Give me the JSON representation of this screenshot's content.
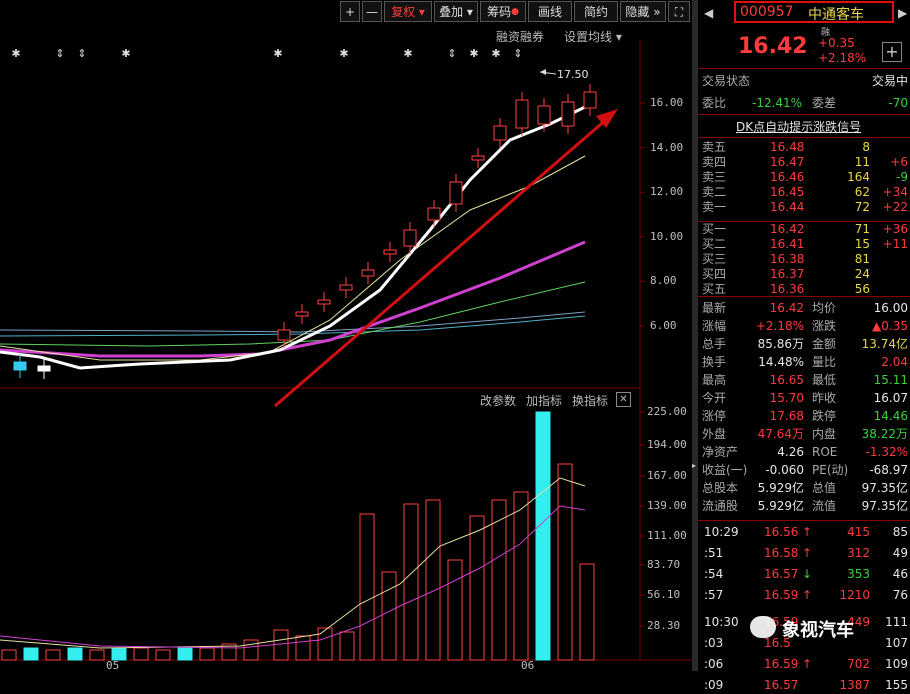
{
  "toolbar": {
    "plus": "+",
    "minus": "—",
    "fuquan": "复权",
    "diejia": "叠加",
    "chouma": "筹码",
    "huaxian": "画线",
    "jianyue": "简约",
    "yincang": "隐藏",
    "expand": "⛶"
  },
  "subbar": {
    "rongzi": "融资融券",
    "junxian": "设置均线"
  },
  "chart": {
    "max_label": "17.50",
    "price_ticks": [
      "16.00",
      "14.00",
      "12.00",
      "10.00",
      "8.00",
      "6.00"
    ],
    "volume_ticks": [
      "225.00",
      "194.00",
      "167.00",
      "139.00",
      "111.00",
      "83.70",
      "56.10",
      "28.30"
    ],
    "x_labels": [
      "05",
      "06"
    ],
    "indicator_buttons": [
      "改参数",
      "加指标",
      "换指标"
    ]
  },
  "stock": {
    "code": "000957",
    "name": "中通客车",
    "rong": "融",
    "price": "16.42",
    "change": "+0.35",
    "change_pct": "+2.18%",
    "status_label": "交易状态",
    "status_value": "交易中",
    "weibi_label": "委比",
    "weibi": "-12.41%",
    "weicha_label": "委差",
    "weicha": "-70",
    "signal": "DK点自动提示涨跌信号"
  },
  "asks": [
    {
      "label": "卖五",
      "price": "16.48",
      "vol": "8",
      "chg": ""
    },
    {
      "label": "卖四",
      "price": "16.47",
      "vol": "11",
      "chg": "+6"
    },
    {
      "label": "卖三",
      "price": "16.46",
      "vol": "164",
      "chg": "-9"
    },
    {
      "label": "卖二",
      "price": "16.45",
      "vol": "62",
      "chg": "+34"
    },
    {
      "label": "卖一",
      "price": "16.44",
      "vol": "72",
      "chg": "+22"
    }
  ],
  "bids": [
    {
      "label": "买一",
      "price": "16.42",
      "vol": "71",
      "chg": "+36"
    },
    {
      "label": "买二",
      "price": "16.41",
      "vol": "15",
      "chg": "+11"
    },
    {
      "label": "买三",
      "price": "16.38",
      "vol": "81",
      "chg": ""
    },
    {
      "label": "买四",
      "price": "16.37",
      "vol": "24",
      "chg": ""
    },
    {
      "label": "买五",
      "price": "16.36",
      "vol": "56",
      "chg": ""
    }
  ],
  "stats": [
    {
      "l1": "最新",
      "v1": "16.42",
      "l2": "均价",
      "v2": "16.00"
    },
    {
      "l1": "涨幅",
      "v1": "+2.18%",
      "l2": "涨跌",
      "v2": "▲0.35"
    },
    {
      "l1": "总手",
      "v1": "85.86万",
      "l2": "金额",
      "v2": "13.74亿"
    },
    {
      "l1": "换手",
      "v1": "14.48%",
      "l2": "量比",
      "v2": "2.04"
    },
    {
      "l1": "最高",
      "v1": "16.65",
      "l2": "最低",
      "v2": "15.11"
    },
    {
      "l1": "今开",
      "v1": "15.70",
      "l2": "昨收",
      "v2": "16.07"
    },
    {
      "l1": "涨停",
      "v1": "17.68",
      "l2": "跌停",
      "v2": "14.46"
    },
    {
      "l1": "外盘",
      "v1": "47.64万",
      "l2": "内盘",
      "v2": "38.22万"
    },
    {
      "l1": "净资产",
      "v1": "4.26",
      "l2": "ROE",
      "v2": "-1.32%"
    },
    {
      "l1": "收益(一)",
      "v1": "-0.060",
      "l2": "PE(动)",
      "v2": "-68.97"
    },
    {
      "l1": "总股本",
      "v1": "5.929亿",
      "l2": "总值",
      "v2": "97.35亿"
    },
    {
      "l1": "流通股",
      "v1": "5.929亿",
      "l2": "流值",
      "v2": "97.35亿"
    }
  ],
  "ticks": [
    {
      "time": "10:29",
      "price": "16.56",
      "dir": "↑",
      "vol": "415",
      "n": "85"
    },
    {
      "time": ":51",
      "price": "16.58",
      "dir": "↑",
      "vol": "312",
      "n": "49"
    },
    {
      "time": ":54",
      "price": "16.57",
      "dir": "↓",
      "vol": "353",
      "n": "46"
    },
    {
      "time": ":57",
      "price": "16.59",
      "dir": "↑",
      "vol": "1210",
      "n": "76"
    },
    {
      "time": "10:30",
      "price": "16.59",
      "dir": "",
      "vol": "449",
      "n": "111"
    },
    {
      "time": ":03",
      "price": "16.5",
      "dir": "",
      "vol": "",
      "n": "107"
    },
    {
      "time": ":06",
      "price": "16.59",
      "dir": "↑",
      "vol": "702",
      "n": "109"
    },
    {
      "time": ":09",
      "price": "16.57",
      "dir": "",
      "vol": "1387",
      "n": "155"
    }
  ],
  "watermark": "象视汽车"
}
